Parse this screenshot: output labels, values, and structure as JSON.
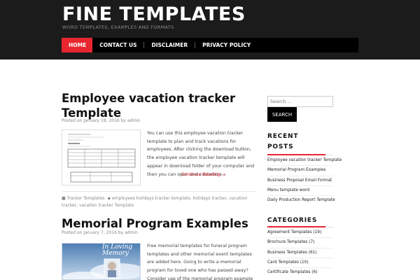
{
  "header": {
    "site_title": "FINE TEMPLATES",
    "tagline": "WORD TEMPLATES, EXAMPLES AND FORMATS"
  },
  "nav": [
    "HOME",
    "CONTACT US",
    "DISCLAIMER",
    "PRIVACY POLICY"
  ],
  "posts": [
    {
      "title": "Employee vacation tracker Template",
      "meta": "Posted on January 18, 2016 by admin",
      "excerpt": "You can use this employee vacation tracker template to plan and track vacations for employees. After clicking the download button, the employee vacation tracker template will appear in download folder of your computer and then you can open and customize…",
      "continue": "Continue Reading →",
      "category": "Tracker Templates",
      "tags": "employees holidays tracker template, holidays tracker, vacation tracker, vacation tracker Template"
    },
    {
      "title": "Memorial Program Examples",
      "meta": "Posted on January 7, 2016 by admin",
      "excerpt": "Free memorial templates for funeral program templates and other memorial event templates are added here. Going to write a memorial program for loved one who has passed away? Consider use of the memorial program example given below the content. It…",
      "thumb_text": "In Loving Memory"
    }
  ],
  "sidebar": {
    "search_placeholder": "Search …",
    "search_button": "SEARCH",
    "recent_title_1": "RECENT",
    "recent_title_2": "POSTS",
    "recent": [
      "Employee vacation tracker Template",
      "Memorial Program Examples",
      "Business Proposal Email Format",
      "Menu template word",
      "Daily Production Report Template"
    ],
    "categories_title": "CATEGORIES",
    "categories": [
      "Agreement Templates (19)",
      "Brochure Templates (7)",
      "Business Templates (61)",
      "Card Templates (10)",
      "Certificate Templates (6)"
    ]
  },
  "colors": {
    "accent": "#e8262f",
    "header_bg": "#1b1b1b",
    "nav_bg": "#000000"
  },
  "icons": {
    "category": "folder-icon",
    "tags": "tag-icon"
  }
}
